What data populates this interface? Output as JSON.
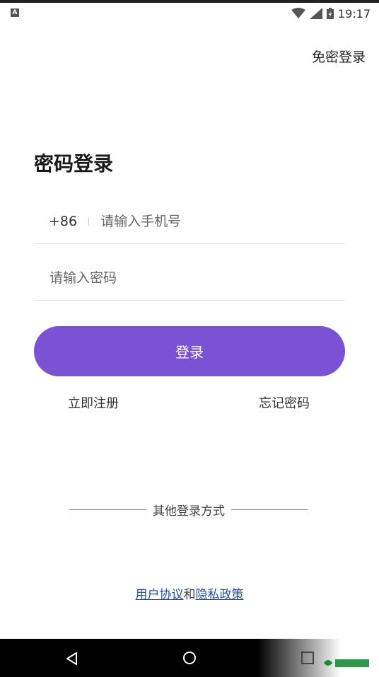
{
  "status_bar": {
    "notification_letter": "A",
    "time": "19:17"
  },
  "header": {
    "passwordless_login": "免密登录"
  },
  "form": {
    "title": "密码登录",
    "country_code": "+86",
    "phone_placeholder": "请输入手机号",
    "password_placeholder": "请输入密码",
    "login_label": "登录",
    "register_label": "立即注册",
    "forgot_label": "忘记密码"
  },
  "other_methods": {
    "label": "其他登录方式"
  },
  "agreement": {
    "user_agreement": "用户协议",
    "conjunction": "和",
    "privacy_policy": "隐私政策"
  },
  "colors": {
    "accent": "#7b52d3",
    "link": "#1f4fa8"
  },
  "icons": {
    "back": "back-triangle-icon",
    "home": "home-circle-icon",
    "recent": "recent-square-icon",
    "wifi": "wifi-icon",
    "signal": "signal-icon",
    "battery": "battery-icon"
  }
}
